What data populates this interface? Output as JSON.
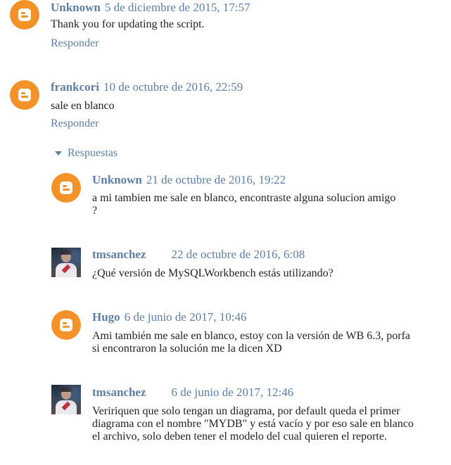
{
  "colors": {
    "link": "#5e7fa5",
    "text": "#222222",
    "blogger_orange": "#f4922a"
  },
  "comments": [
    {
      "author": "Unknown",
      "date": "5 de diciembre de 2015, 17:57",
      "body": "Thank you for updating the script.",
      "reply_label": "Responder",
      "avatar": "blogger-icon"
    },
    {
      "author": "frankcori",
      "date": "10 de octubre de 2016, 22:59",
      "body": "sale en blanco",
      "reply_label": "Responder",
      "avatar": "blogger-icon"
    }
  ],
  "replies_toggle": {
    "label": "Respuestas",
    "icon": "triangle-down-icon"
  },
  "replies": [
    {
      "author": "Unknown",
      "date": "21 de octubre de 2016, 19:22",
      "body_lines": [
        "a mi tambien me sale en blanco, encontraste alguna solucion amigo",
        "?"
      ],
      "avatar": "blogger-icon"
    },
    {
      "author": "tmsanchez",
      "date": "22 de octubre de 2016, 6:08",
      "body_lines": [
        "¿Qué versión de MySQLWorkbench estás utilizando?"
      ],
      "avatar": "user-photo"
    },
    {
      "author": "Hugo",
      "date": "6 de junio de 2017, 10:46",
      "body_lines": [
        "Ami también me sale en blanco, estoy con la versión de WB 6.3, porfa",
        "si encontraron la solución me la dicen XD"
      ],
      "avatar": "blogger-icon"
    },
    {
      "author": "tmsanchez",
      "date": "6 de junio de 2017, 12:46",
      "body_lines": [
        "Veririquen que solo tengan un diagrama, por default queda el primer",
        "diagrama con el nombre \"MYDB\" y está vacío y por eso sale en blanco",
        "el archivo, solo deben tener el modelo del cual quieren el reporte."
      ],
      "avatar": "user-photo"
    }
  ]
}
